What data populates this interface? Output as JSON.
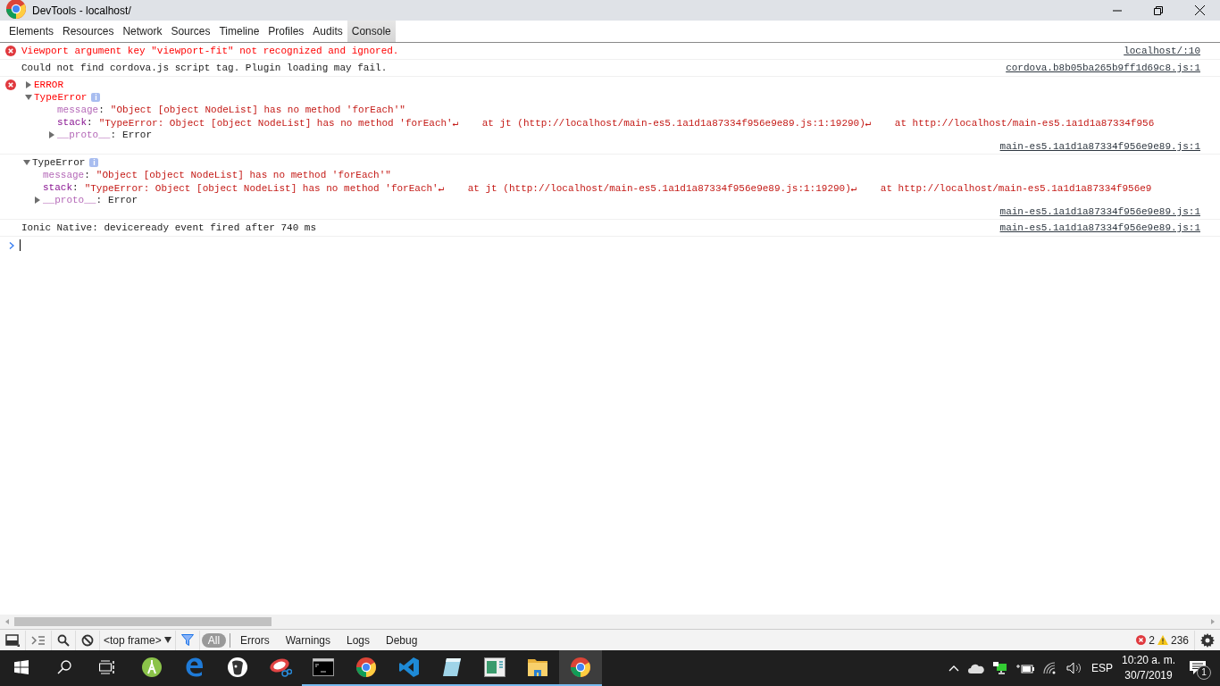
{
  "window": {
    "title": "DevTools - localhost/"
  },
  "tabs": [
    {
      "label": "Elements",
      "selected": false
    },
    {
      "label": "Resources",
      "selected": false
    },
    {
      "label": "Network",
      "selected": false
    },
    {
      "label": "Sources",
      "selected": false
    },
    {
      "label": "Timeline",
      "selected": false
    },
    {
      "label": "Profiles",
      "selected": false
    },
    {
      "label": "Audits",
      "selected": false
    },
    {
      "label": "Console",
      "selected": true
    }
  ],
  "console": {
    "messages": [
      {
        "kind": "text",
        "error": true,
        "text": "Viewport argument key \"viewport-fit\" not recognized and ignored.",
        "source": "localhost/:10"
      },
      {
        "kind": "text",
        "error": false,
        "text": "Could not find cordova.js script tag. Plugin loading may fail.",
        "source": "cordova.b8b05ba265b9ff1d69c8.js:1"
      },
      {
        "kind": "group",
        "error": true,
        "label": "ERROR",
        "expanded": false,
        "object": {
          "name": "TypeError",
          "badge": "i",
          "expanded": true,
          "properties": [
            {
              "key": "message",
              "separator": ":",
              "dimmed": true,
              "value": "\"Object [object NodeList] has no method 'forEach'\""
            },
            {
              "key": "stack",
              "separator": ":",
              "dimmed": false,
              "value": "\"TypeError: Object [object NodeList] has no method 'forEach'↵    at jt (http://localhost/main-es5.1a1d1a87334f956e9e89.js:1:19290)↵    at http://localhost/main-es5.1a1d1a87334f956"
            }
          ],
          "proto": {
            "key": "__proto__",
            "separator": ":",
            "value": "Error",
            "expanded": false
          }
        },
        "source": "main-es5.1a1d1a87334f956e9e89.js:1"
      },
      {
        "kind": "object",
        "error": false,
        "object": {
          "name": "TypeError",
          "badge": "i",
          "expanded": true,
          "properties": [
            {
              "key": "message",
              "separator": ":",
              "dimmed": true,
              "value": "\"Object [object NodeList] has no method 'forEach'\""
            },
            {
              "key": "stack",
              "separator": ":",
              "dimmed": false,
              "value": "\"TypeError: Object [object NodeList] has no method 'forEach'↵    at jt (http://localhost/main-es5.1a1d1a87334f956e9e89.js:1:19290)↵    at http://localhost/main-es5.1a1d1a87334f956e9"
            }
          ],
          "proto": {
            "key": "__proto__",
            "separator": ":",
            "value": "Error",
            "expanded": false
          }
        },
        "source": "main-es5.1a1d1a87334f956e9e89.js:1"
      },
      {
        "kind": "text",
        "error": false,
        "text": "Ionic Native: deviceready event fired after 740 ms",
        "source": "main-es5.1a1d1a87334f956e9e89.js:1"
      }
    ]
  },
  "toolbar": {
    "frame": "<top frame>",
    "filters": [
      {
        "label": "All",
        "selected": true
      },
      {
        "label": "Errors",
        "selected": false
      },
      {
        "label": "Warnings",
        "selected": false
      },
      {
        "label": "Logs",
        "selected": false
      },
      {
        "label": "Debug",
        "selected": false
      }
    ],
    "error_count": "2",
    "warning_count": "236"
  },
  "taskbar": {
    "apps": [
      {
        "kind": "compass",
        "running": false,
        "active": false
      },
      {
        "kind": "browser-e",
        "running": false,
        "active": false
      },
      {
        "kind": "circle-logo",
        "running": false,
        "active": false
      },
      {
        "kind": "scissors",
        "running": false,
        "active": false
      },
      {
        "kind": "terminal",
        "running": true,
        "active": false
      },
      {
        "kind": "wheel",
        "running": true,
        "active": false
      },
      {
        "kind": "ribbon",
        "running": true,
        "active": false
      },
      {
        "kind": "notepad",
        "running": true,
        "active": false
      },
      {
        "kind": "window",
        "running": true,
        "active": false
      },
      {
        "kind": "folder",
        "running": true,
        "active": false
      },
      {
        "kind": "wheel",
        "running": true,
        "active": true
      }
    ],
    "language": "ESP",
    "time": "10:20 a. m.",
    "date": "30/7/2019",
    "notifications": "1"
  }
}
